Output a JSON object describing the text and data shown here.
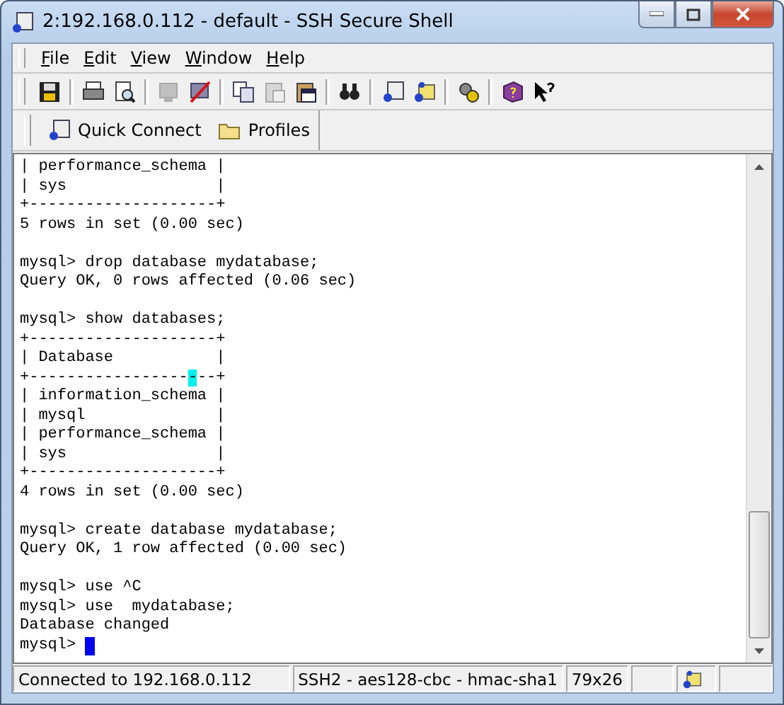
{
  "window": {
    "title": "2:192.168.0.112 - default - SSH Secure Shell"
  },
  "menu": [
    {
      "label": "File"
    },
    {
      "label": "Edit"
    },
    {
      "label": "View"
    },
    {
      "label": "Window"
    },
    {
      "label": "Help"
    }
  ],
  "toolbar": [
    {
      "kind": "save",
      "disabled": false
    },
    {
      "kind": "sep"
    },
    {
      "kind": "print",
      "disabled": false
    },
    {
      "kind": "preview",
      "disabled": false
    },
    {
      "kind": "sep"
    },
    {
      "kind": "connect",
      "disabled": true
    },
    {
      "kind": "disconnect",
      "disabled": false
    },
    {
      "kind": "sep"
    },
    {
      "kind": "copy",
      "disabled": false
    },
    {
      "kind": "paste",
      "disabled": true
    },
    {
      "kind": "clipboard",
      "disabled": false
    },
    {
      "kind": "sep"
    },
    {
      "kind": "find",
      "disabled": false
    },
    {
      "kind": "sep"
    },
    {
      "kind": "terminal",
      "disabled": false
    },
    {
      "kind": "transfer",
      "disabled": false
    },
    {
      "kind": "sep"
    },
    {
      "kind": "settings",
      "disabled": false
    },
    {
      "kind": "sep"
    },
    {
      "kind": "help",
      "disabled": false
    },
    {
      "kind": "whatsthis",
      "disabled": false
    }
  ],
  "quickbar": [
    {
      "kind": "connect",
      "label": "Quick Connect"
    },
    {
      "kind": "folder",
      "label": "Profiles"
    }
  ],
  "terminal": {
    "blocks": [
      {
        "lines": [
          {
            "text": "| performance_schema |"
          },
          {
            "text": "| sys                |"
          },
          {
            "text": "+--------------------+"
          },
          {
            "text": "5 rows in set (0.00 sec)"
          }
        ]
      },
      {
        "lines": [
          {
            "text": "mysql> drop database mydatabase;"
          },
          {
            "text": "Query OK, 0 rows affected (0.06 sec)"
          }
        ]
      },
      {
        "lines": [
          {
            "text": "mysql> show databases;"
          },
          {
            "text": "+--------------------+"
          },
          {
            "text": "| Database           |"
          },
          {
            "segments": [
              {
                "text": "+-----------------",
                "highlighted": false
              },
              {
                "text": "-",
                "highlighted": true
              },
              {
                "text": "--+",
                "highlighted": false
              }
            ]
          },
          {
            "text": "| information_schema |"
          },
          {
            "text": "| mysql              |"
          },
          {
            "text": "| performance_schema |"
          },
          {
            "text": "| sys                |"
          },
          {
            "text": "+--------------------+"
          },
          {
            "text": "4 rows in set (0.00 sec)"
          }
        ]
      },
      {
        "lines": [
          {
            "text": "mysql> create database mydatabase;"
          },
          {
            "text": "Query OK, 1 row affected (0.00 sec)"
          }
        ]
      },
      {
        "lines": [
          {
            "text": "mysql> use ^C"
          },
          {
            "text": "mysql> use  mydatabase;"
          },
          {
            "text": "Database changed"
          },
          {
            "text": "mysql> ",
            "cursor": true
          }
        ]
      }
    ]
  },
  "status_bar": {
    "connection": "Connected to 192.168.0.112",
    "cipher": "SSH2 - aes128-cbc - hmac-sha1",
    "size": "79x26"
  }
}
